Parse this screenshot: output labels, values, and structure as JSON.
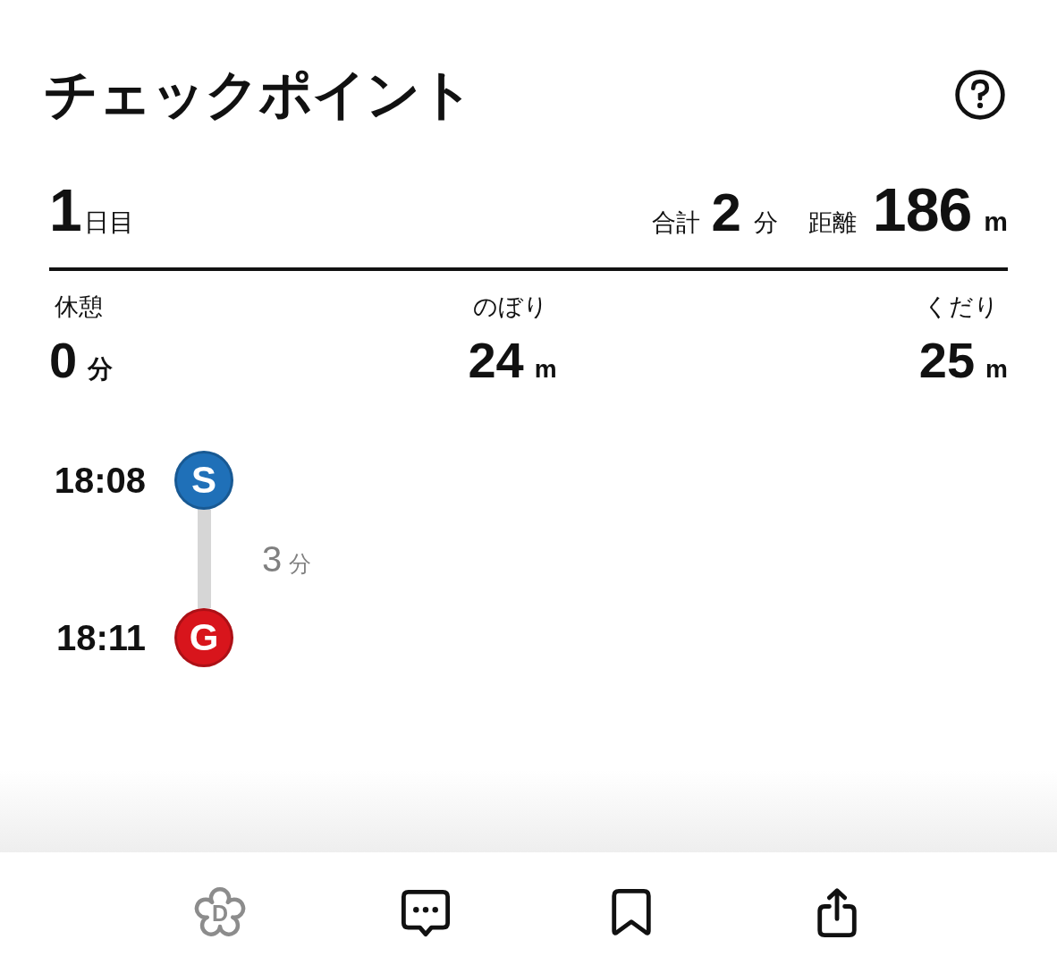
{
  "header": {
    "title": "チェックポイント"
  },
  "day": {
    "number": "1",
    "suffix": "日目",
    "total_label": "合計",
    "total_value": "2",
    "total_unit": "分",
    "distance_label": "距離",
    "distance_value": "186",
    "distance_unit": "m"
  },
  "stats": [
    {
      "label": "休憩",
      "value": "0",
      "unit": "分"
    },
    {
      "label": "のぼり",
      "value": "24",
      "unit": "m"
    },
    {
      "label": "くだり",
      "value": "25",
      "unit": "m"
    }
  ],
  "checkpoints": [
    {
      "time": "18:08",
      "letter": "S",
      "color": "#1f70b8"
    },
    {
      "time": "18:11",
      "letter": "G",
      "color": "#d8151c"
    }
  ],
  "segments": [
    {
      "value": "3",
      "unit": "分"
    }
  ],
  "toolbar": [
    {
      "kind": "flower",
      "letter": "D",
      "disabled": true
    },
    {
      "kind": "comment",
      "disabled": false
    },
    {
      "kind": "bookmark",
      "disabled": false
    },
    {
      "kind": "share",
      "disabled": false
    }
  ]
}
